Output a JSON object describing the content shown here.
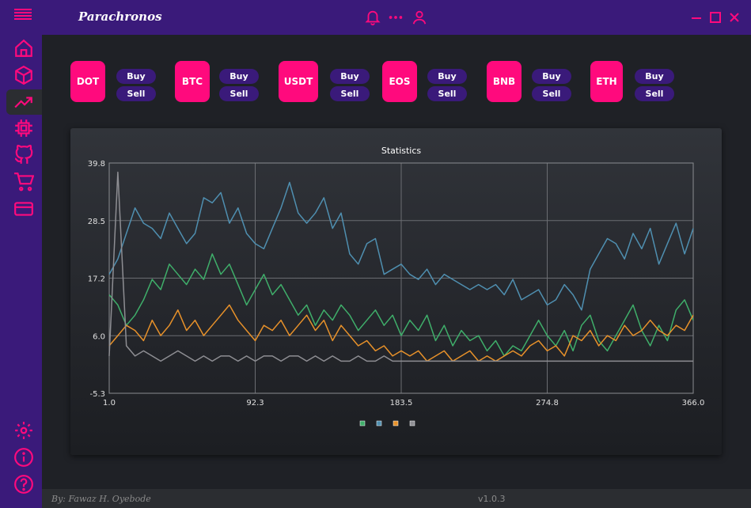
{
  "app": {
    "title": "Parachronos"
  },
  "colors": {
    "accent": "#ff0a7d",
    "brand": "#3a1a7a",
    "background": "#1f2126"
  },
  "coins": [
    {
      "symbol": "DOT",
      "buy_label": "Buy",
      "sell_label": "Sell"
    },
    {
      "symbol": "BTC",
      "buy_label": "Buy",
      "sell_label": "Sell"
    },
    {
      "symbol": "USDT",
      "buy_label": "Buy",
      "sell_label": "Sell"
    },
    {
      "symbol": "EOS",
      "buy_label": "Buy",
      "sell_label": "Sell"
    },
    {
      "symbol": "BNB",
      "buy_label": "Buy",
      "sell_label": "Sell"
    },
    {
      "symbol": "ETH",
      "buy_label": "Buy",
      "sell_label": "Sell"
    }
  ],
  "sidebar": {
    "items": [
      "home-icon",
      "cube-icon",
      "trending-up-icon",
      "chip-icon",
      "github-icon",
      "cart-icon",
      "credit-card-icon"
    ],
    "bottom": [
      "settings-icon",
      "info-icon",
      "help-icon"
    ]
  },
  "header_icons": [
    "bell-icon",
    "more-icon",
    "user-icon"
  ],
  "footer": {
    "author": "By: Fawaz H. Oyebode",
    "version": "v1.0.3"
  },
  "chart_data": {
    "type": "line",
    "title": "Statistics",
    "xlim": [
      1.0,
      366.0
    ],
    "ylim": [
      -5.3,
      39.8
    ],
    "x_ticks": [
      "1.0",
      "92.3",
      "183.5",
      "274.8",
      "366.0"
    ],
    "y_ticks": [
      "-5.3",
      "6.0",
      "17.2",
      "28.5",
      "39.8"
    ],
    "grid": true,
    "legend": "bottom-center",
    "series": [
      {
        "color": "#3fae6a",
        "values": [
          14,
          12,
          8,
          10,
          13,
          17,
          15,
          20,
          18,
          16,
          19,
          17,
          22,
          18,
          20,
          16,
          12,
          15,
          18,
          14,
          16,
          13,
          10,
          12,
          8,
          11,
          9,
          12,
          10,
          7,
          9,
          11,
          8,
          10,
          6,
          9,
          7,
          10,
          5,
          8,
          4,
          7,
          5,
          6,
          3,
          5,
          2,
          4,
          3,
          6,
          9,
          6,
          4,
          7,
          3,
          8,
          10,
          5,
          3,
          6,
          9,
          12,
          7,
          4,
          8,
          5,
          11,
          13,
          9
        ]
      },
      {
        "color": "#4f8fb0",
        "values": [
          18,
          21,
          26,
          31,
          28,
          27,
          25,
          30,
          27,
          24,
          26,
          33,
          32,
          34,
          28,
          31,
          26,
          24,
          23,
          27,
          31,
          36,
          30,
          28,
          30,
          33,
          27,
          30,
          22,
          20,
          24,
          25,
          18,
          19,
          20,
          18,
          17,
          19,
          16,
          18,
          17,
          16,
          15,
          16,
          15,
          16,
          14,
          17,
          13,
          14,
          15,
          12,
          13,
          16,
          14,
          11,
          19,
          22,
          25,
          24,
          21,
          26,
          23,
          27,
          20,
          24,
          28,
          22,
          27
        ]
      },
      {
        "color": "#e7912a",
        "values": [
          4,
          6,
          8,
          7,
          5,
          9,
          6,
          8,
          11,
          7,
          9,
          6,
          8,
          10,
          12,
          9,
          7,
          5,
          8,
          7,
          9,
          6,
          8,
          10,
          7,
          9,
          5,
          8,
          6,
          4,
          5,
          3,
          4,
          2,
          3,
          2,
          3,
          1,
          2,
          3,
          1,
          2,
          3,
          1,
          2,
          1,
          2,
          3,
          2,
          4,
          5,
          3,
          4,
          2,
          6,
          5,
          7,
          4,
          6,
          5,
          8,
          6,
          7,
          9,
          7,
          6,
          8,
          7,
          10
        ]
      },
      {
        "color": "#8e8e93",
        "values": [
          2,
          38,
          4,
          2,
          3,
          2,
          1,
          2,
          3,
          2,
          1,
          2,
          1,
          2,
          2,
          1,
          2,
          1,
          2,
          2,
          1,
          2,
          2,
          1,
          2,
          1,
          2,
          1,
          1,
          2,
          1,
          1,
          2,
          1,
          1,
          1,
          1,
          1,
          1,
          1,
          1,
          1,
          1,
          1,
          1,
          1,
          1,
          1,
          1,
          1,
          1,
          1,
          1,
          1,
          1,
          1,
          1,
          1,
          1,
          1,
          1,
          1,
          1,
          1,
          1,
          1,
          1,
          1,
          1
        ]
      }
    ]
  }
}
